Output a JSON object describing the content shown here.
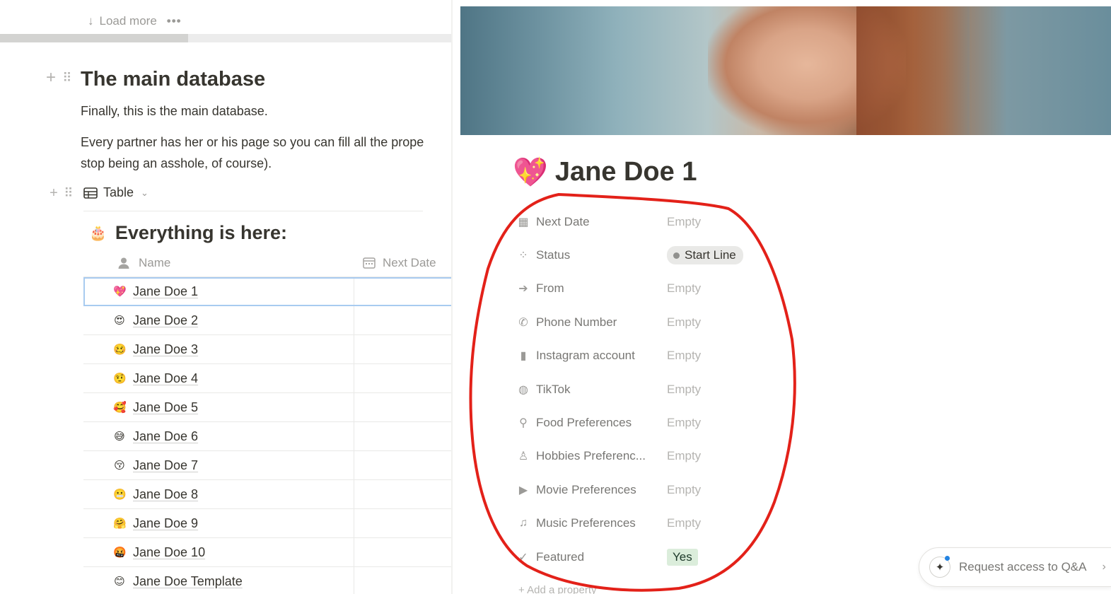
{
  "left_page": {
    "load_more": {
      "label": "Load more",
      "arrow_icon": "arrow-down-icon",
      "more_icon": "ellipsis-icon"
    },
    "heading": "The main database",
    "para1": "Finally, this is the main database.",
    "para2_line1": "Every partner has her or his page so you can fill all the prope",
    "para2_line2": "stop being an asshole, of course).",
    "view_tab": {
      "label": "Table",
      "icon": "table-icon",
      "chevron_icon": "chevron-down-icon"
    },
    "database_title": {
      "emoji": "🎂",
      "text": "Everything is here:"
    },
    "columns": {
      "name": "Name",
      "next_date": "Next Date"
    },
    "rows": [
      {
        "emoji": "💖",
        "name": "Jane Doe 1"
      },
      {
        "emoji": "😍",
        "name": "Jane Doe 2"
      },
      {
        "emoji": "🥴",
        "name": "Jane Doe 3"
      },
      {
        "emoji": "🤨",
        "name": "Jane Doe 4"
      },
      {
        "emoji": "🥰",
        "name": "Jane Doe 5"
      },
      {
        "emoji": "😅",
        "name": "Jane Doe 6"
      },
      {
        "emoji": "😚",
        "name": "Jane Doe 7"
      },
      {
        "emoji": "😬",
        "name": "Jane Doe 8"
      },
      {
        "emoji": "🤗",
        "name": "Jane Doe 9"
      },
      {
        "emoji": "🤬",
        "name": "Jane Doe 10"
      },
      {
        "emoji": "😊",
        "name": "Jane Doe Template"
      }
    ]
  },
  "right_page": {
    "title_emoji": "💖",
    "title": "Jane Doe 1",
    "properties": [
      {
        "icon": "calendar-icon",
        "glyph": "▦",
        "name": "Next Date",
        "value": "Empty",
        "type": "empty"
      },
      {
        "icon": "status-icon",
        "glyph": "⁘",
        "name": "Status",
        "value": "Start Line",
        "type": "status"
      },
      {
        "icon": "arrow-right-circle-icon",
        "glyph": "➔",
        "name": "From",
        "value": "Empty",
        "type": "empty"
      },
      {
        "icon": "phone-icon",
        "glyph": "✆",
        "name": "Phone Number",
        "value": "Empty",
        "type": "empty"
      },
      {
        "icon": "mobile-icon",
        "glyph": "▮",
        "name": "Instagram account",
        "value": "Empty",
        "type": "empty"
      },
      {
        "icon": "globe-icon",
        "glyph": "◍",
        "name": "TikTok",
        "value": "Empty",
        "type": "empty"
      },
      {
        "icon": "drumstick-icon",
        "glyph": "⚲",
        "name": "Food Preferences",
        "value": "Empty",
        "type": "empty"
      },
      {
        "icon": "cake-icon",
        "glyph": "♙",
        "name": "Hobbies Preferenc...",
        "value": "Empty",
        "type": "empty"
      },
      {
        "icon": "video-camera-icon",
        "glyph": "▶",
        "name": "Movie Preferences",
        "value": "Empty",
        "type": "empty"
      },
      {
        "icon": "music-icon",
        "glyph": "♫",
        "name": "Music Preferences",
        "value": "Empty",
        "type": "empty"
      },
      {
        "icon": "check-circle-icon",
        "glyph": "✓",
        "name": "Featured",
        "value": "Yes",
        "type": "yes"
      }
    ],
    "qa_button": {
      "label": "Request access to Q&A",
      "icon": "sparkle-icon",
      "chevron_icon": "chevron-right-icon"
    }
  },
  "colors": {
    "text": "#37352f",
    "muted": "#9b9a97",
    "empty": "#b5b4b1",
    "annotation": "#e32119",
    "selection": "#a8cbf0",
    "yes_bg": "#dbeddb",
    "status_bg": "#e9e9e7"
  }
}
